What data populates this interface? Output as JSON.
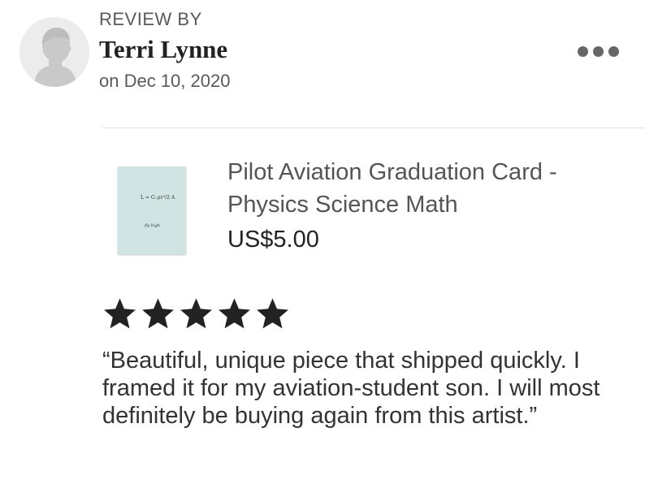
{
  "review": {
    "header_label": "REVIEW BY",
    "reviewer_name": "Terri Lynne",
    "date": "on Dec 10, 2020",
    "rating": 5,
    "max_rating": 5,
    "text": "“Beautiful, unique piece that shipped quickly. I framed it for my aviation-student son. I will most definitely be buying again from this artist.”"
  },
  "menu": {
    "icon": "more-options-icon"
  },
  "avatar": {
    "icon": "default-user-avatar-icon",
    "background": "#ececec"
  },
  "product": {
    "title": "Pilot Aviation Graduation Card - Physics Science Math",
    "price": "US$5.00",
    "image": {
      "background": "#cfe4e3",
      "formula": "L = Cₗ ρv²/2 A",
      "caption": "fly high"
    }
  },
  "colors": {
    "star": "#222222",
    "muted_text": "#595959",
    "divider": "#e1e1e1"
  }
}
